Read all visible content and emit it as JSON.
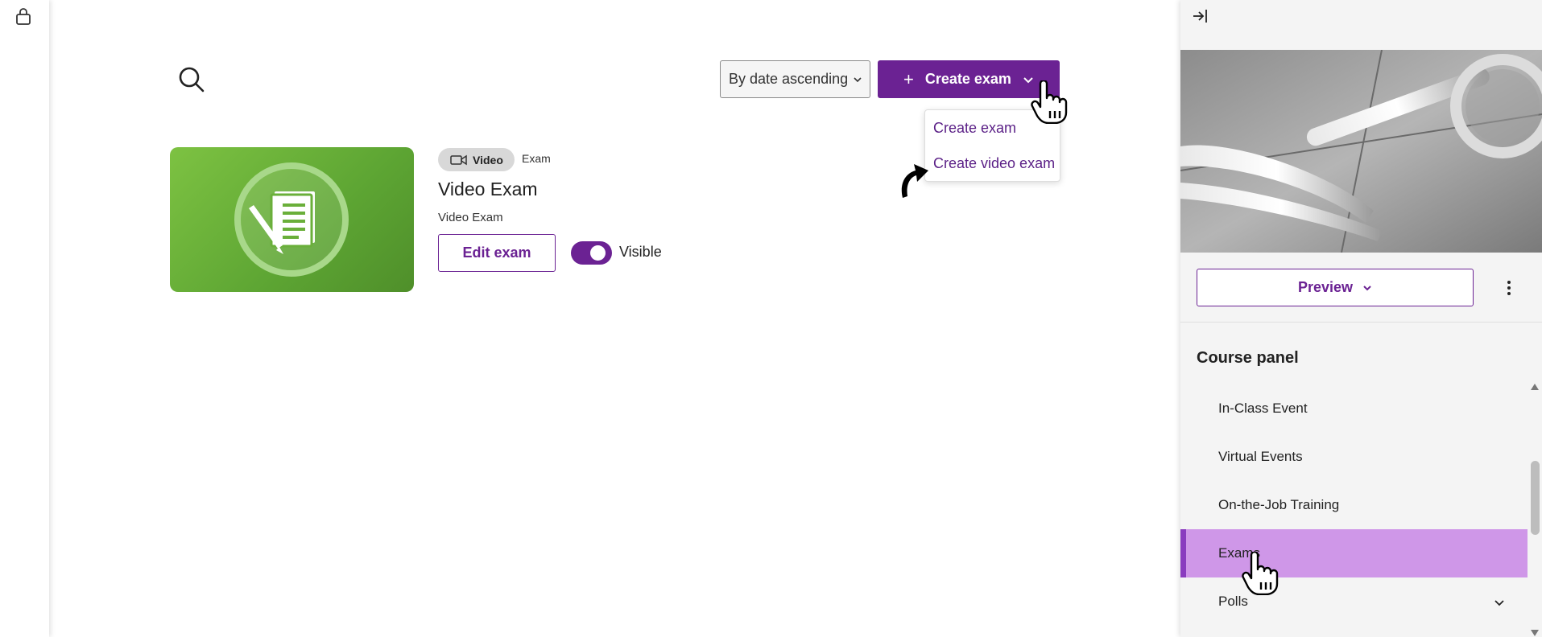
{
  "toolbar": {
    "sort_label": "By date ascending",
    "create_label": "Create exam",
    "create_plus": "+"
  },
  "create_menu": {
    "items": [
      "Create exam",
      "Create video exam"
    ]
  },
  "exam_card": {
    "badge_video": "Video",
    "badge_type": "Exam",
    "title": "Video Exam",
    "subtitle": "Video Exam",
    "edit_label": "Edit exam",
    "visible_label": "Visible",
    "visible_on": true
  },
  "right_panel": {
    "preview_label": "Preview",
    "heading": "Course panel",
    "nav_items": [
      {
        "label": "In-Class Event",
        "active": false
      },
      {
        "label": "Virtual Events",
        "active": false
      },
      {
        "label": "On-the-Job Training",
        "active": false
      },
      {
        "label": "Exams",
        "active": true
      },
      {
        "label": "Polls",
        "active": false,
        "expandable": true
      }
    ]
  },
  "colors": {
    "accent": "#6b2293",
    "active_nav_bg": "#cf97e8",
    "active_nav_border": "#8a3cbf",
    "thumb_green": "#6aaf3a"
  },
  "icons": [
    "lock-icon",
    "search-icon",
    "chevron-down-icon",
    "plus-icon",
    "video-camera-icon",
    "exam-document-icon",
    "collapse-panel-icon",
    "kebab-menu-icon",
    "hand-cursor-icon",
    "curved-arrow-icon"
  ]
}
